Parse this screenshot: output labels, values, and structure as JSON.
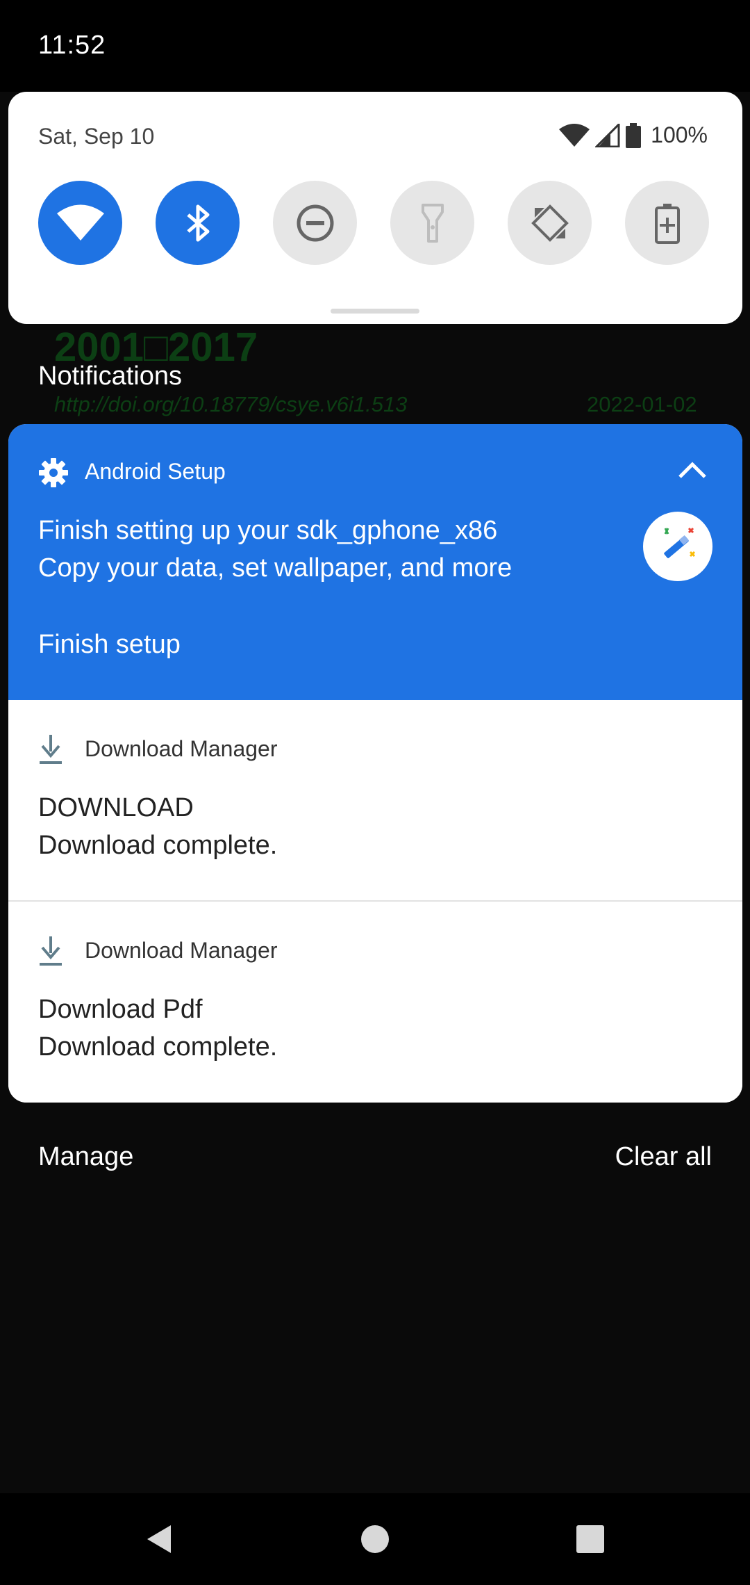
{
  "status_bar": {
    "time": "11:52"
  },
  "quick_settings": {
    "date": "Sat, Sep 10",
    "battery": "100%",
    "tiles": [
      {
        "name": "wifi",
        "state": "on"
      },
      {
        "name": "bluetooth",
        "state": "on"
      },
      {
        "name": "do-not-disturb",
        "state": "off"
      },
      {
        "name": "flashlight",
        "state": "off"
      },
      {
        "name": "auto-rotate",
        "state": "off"
      },
      {
        "name": "battery-saver",
        "state": "off"
      }
    ]
  },
  "background": {
    "title": "2001□2017",
    "link": "http://doi.org/10.18779/csye.v6i1.513",
    "date": "2022-01-02"
  },
  "notifications_header": "Notifications",
  "setup_notification": {
    "app_name": "Android Setup",
    "title": "Finish setting up your sdk_gphone_x86",
    "text": "Copy your data, set wallpaper, and more",
    "action": "Finish setup",
    "color": "#1f73e3"
  },
  "download_notifications": [
    {
      "app_name": "Download Manager",
      "title": "DOWNLOAD",
      "text": "Download complete."
    },
    {
      "app_name": "Download Manager",
      "title": "Download Pdf",
      "text": "Download complete."
    }
  ],
  "footer": {
    "manage": "Manage",
    "clear_all": "Clear all"
  },
  "nav": {
    "icons": [
      "back-icon",
      "home-icon",
      "recents-icon"
    ]
  }
}
